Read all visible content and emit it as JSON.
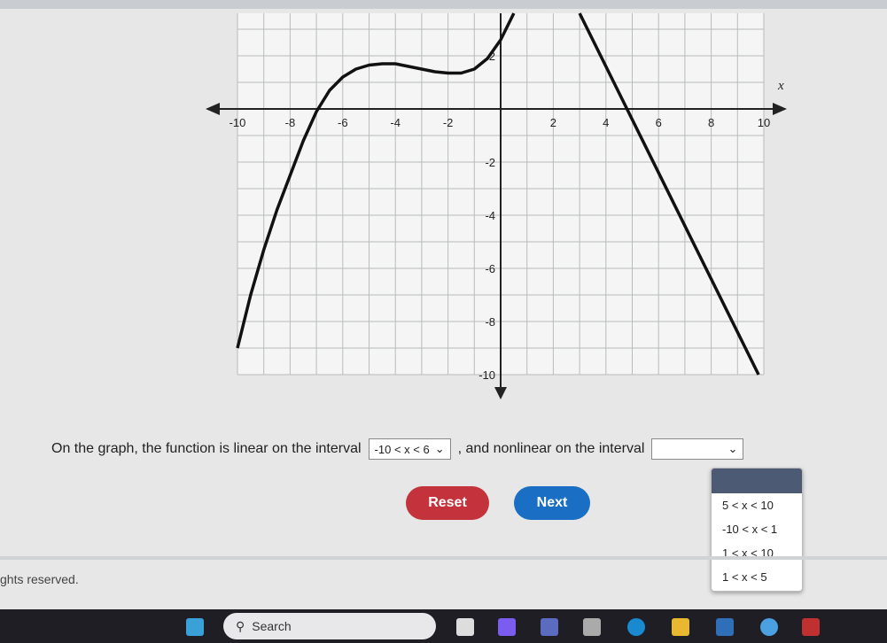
{
  "chart_data": {
    "type": "line",
    "xlim": [
      -10,
      10
    ],
    "ylim": [
      -10,
      3.6
    ],
    "grid": true,
    "x_ticks": [
      "-10",
      "-8",
      "-6",
      "-4",
      "-2",
      "2",
      "4",
      "6",
      "8",
      "10"
    ],
    "y_ticks": [
      "2",
      "-2",
      "-4",
      "-6",
      "-8",
      "-10"
    ],
    "x_axis_label": "x",
    "series": [
      {
        "x": [
          -10,
          -9.5,
          -9,
          -8.5,
          -8,
          -7.5,
          -7,
          -6.5,
          -6,
          -5.5,
          -5,
          -4.5,
          -4,
          -3.5,
          -3,
          -2.5,
          -2,
          -1.5,
          -1,
          -0.5,
          0,
          0.5
        ],
        "y": [
          -9,
          -7,
          -5.3,
          -3.8,
          -2.5,
          -1.2,
          -0.1,
          0.7,
          1.2,
          1.5,
          1.65,
          1.7,
          1.7,
          1.6,
          1.5,
          1.4,
          1.35,
          1.35,
          1.5,
          1.9,
          2.6,
          3.6
        ]
      },
      {
        "x": [
          3,
          9.8
        ],
        "y": [
          3.6,
          -10
        ]
      }
    ],
    "line_color": "#111111"
  },
  "question": {
    "prefix": "On the graph, the function is linear on the interval",
    "linear_selected": "-10 < x < 6",
    "middle": ", and nonlinear on the interval",
    "nonlinear_selected": ""
  },
  "dropdown": {
    "options": [
      "5 < x < 10",
      "-10 < x < 1",
      "1 < x < 10",
      "1 < x < 5"
    ]
  },
  "buttons": {
    "reset": "Reset",
    "next": "Next",
    "reset_color": "#c4333b",
    "next_color": "#1a6fc4"
  },
  "footer": "ghts reserved.",
  "taskbar": {
    "search": "Search"
  }
}
